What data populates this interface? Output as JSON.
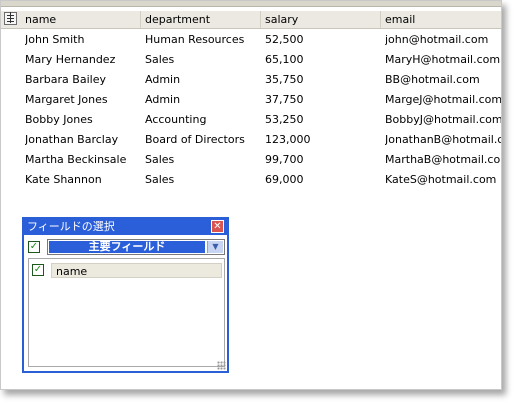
{
  "grid": {
    "columns": [
      "name",
      "department",
      "salary",
      "email"
    ],
    "rows": [
      [
        "John Smith",
        "Human Resources",
        "52,500",
        "john@hotmail.com"
      ],
      [
        "Mary Hernandez",
        "Sales",
        "65,100",
        "MaryH@hotmail.com"
      ],
      [
        "Barbara Bailey",
        "Admin",
        "35,750",
        "BB@hotmail.com"
      ],
      [
        "Margaret Jones",
        "Admin",
        "37,750",
        "MargeJ@hotmail.com"
      ],
      [
        "Bobby Jones",
        "Accounting",
        "53,250",
        "BobbyJ@hotmail.com"
      ],
      [
        "Jonathan Barclay",
        "Board of Directors",
        "123,000",
        "JonathanB@hotmail.co"
      ],
      [
        "Martha Beckinsale",
        "Sales",
        "99,700",
        "MarthaB@hotmail.com"
      ],
      [
        "Kate Shannon",
        "Sales",
        "69,000",
        "KateS@hotmail.com"
      ]
    ]
  },
  "field_chooser": {
    "title": "フィールドの選択",
    "close_glyph": "✕",
    "group_selected": "主要フィールド",
    "group_checked": true,
    "items": [
      {
        "label": "name",
        "checked": true
      }
    ]
  },
  "icons": {
    "check": "✓",
    "dropdown": "▼"
  },
  "colors": {
    "accent": "#2b5fd9",
    "header_bg": "#ebe9e1"
  }
}
